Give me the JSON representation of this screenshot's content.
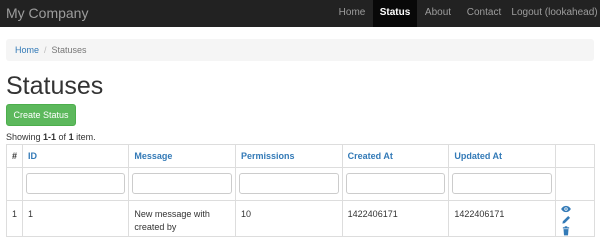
{
  "navbar": {
    "brand": "My Company",
    "items": [
      {
        "label": "Home",
        "active": false
      },
      {
        "label": "Status",
        "active": true
      },
      {
        "label": "About",
        "active": false
      },
      {
        "label": "Contact",
        "active": false
      },
      {
        "label": "Logout (lookahead)",
        "active": false
      }
    ]
  },
  "breadcrumb": {
    "home": "Home",
    "separator": "/",
    "current": "Statuses"
  },
  "page": {
    "title": "Statuses",
    "create_button": "Create Status"
  },
  "summary": {
    "prefix": "Showing ",
    "range": "1-1",
    "middle": " of ",
    "total": "1",
    "suffix": " item."
  },
  "table": {
    "columns": [
      "#",
      "ID",
      "Message",
      "Permissions",
      "Created At",
      "Updated At"
    ],
    "rows": [
      {
        "num": "1",
        "id": "1",
        "message": "New message with created by",
        "permissions": "10",
        "created_at": "1422406171",
        "updated_at": "1422406171"
      }
    ],
    "actions": [
      "eye-icon",
      "pencil-icon",
      "trash-icon"
    ]
  },
  "colors": {
    "navbar_bg": "#222222",
    "link": "#337ab7",
    "success": "#5cb85c"
  }
}
